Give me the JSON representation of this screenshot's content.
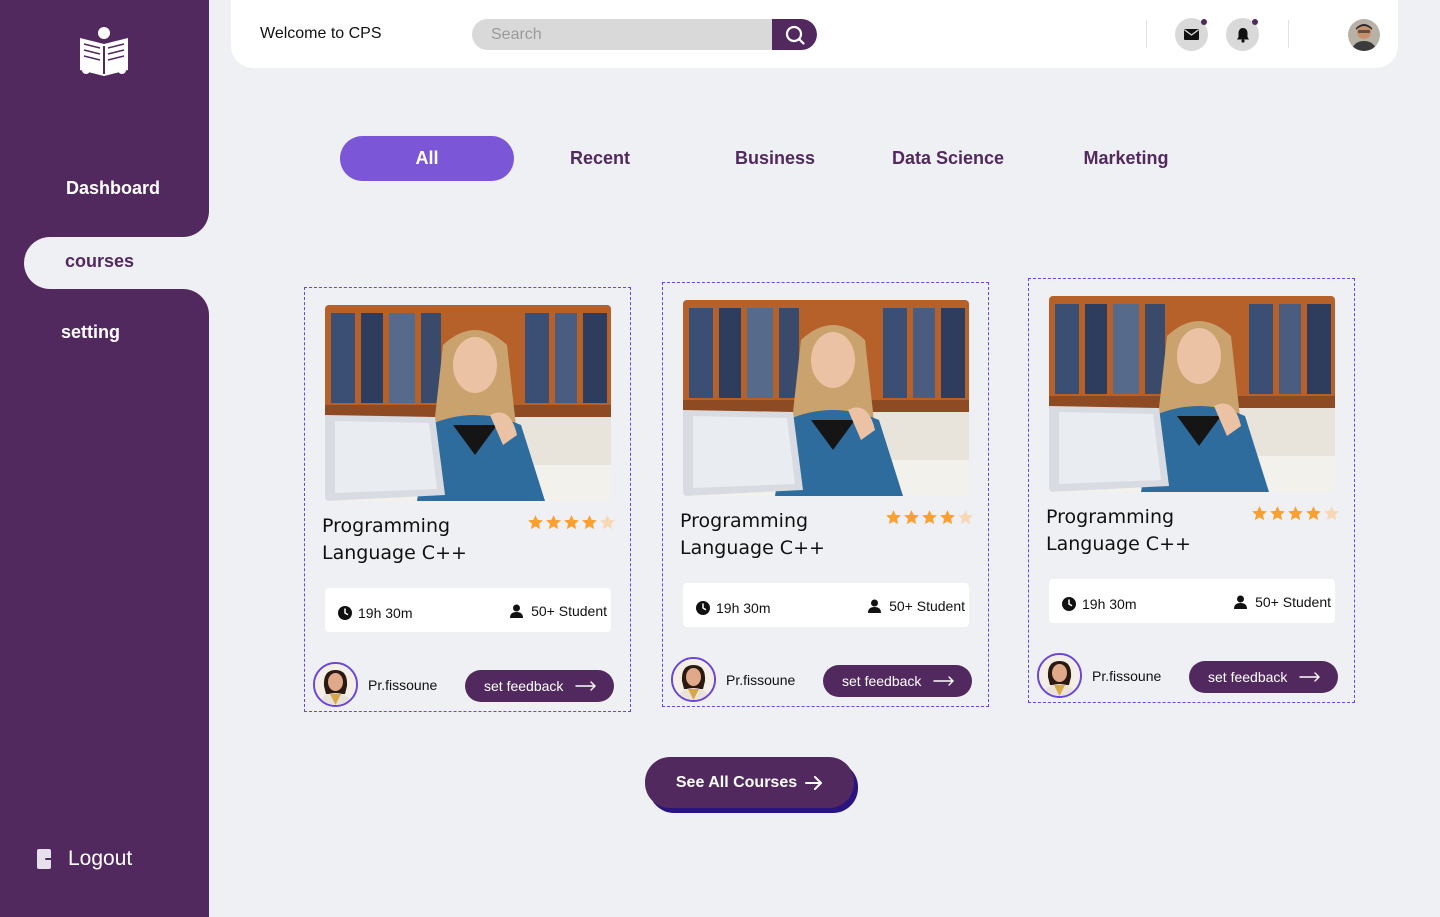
{
  "sidebar": {
    "logo_icon": "reading-person-icon",
    "items": [
      {
        "label": "Dashboard",
        "active": false
      },
      {
        "label": "courses",
        "active": true
      },
      {
        "label": "setting",
        "active": false
      }
    ],
    "logout_label": "Logout",
    "logout_icon": "logout-icon"
  },
  "header": {
    "welcome": "Welcome to CPS",
    "search_placeholder": "Search",
    "icons": [
      "mail-icon",
      "bell-icon",
      "avatar"
    ]
  },
  "tabs": [
    {
      "label": "All",
      "active": true
    },
    {
      "label": "Recent",
      "active": false
    },
    {
      "label": "Business",
      "active": false
    },
    {
      "label": "Data Science",
      "active": false
    },
    {
      "label": "Marketing",
      "active": false
    }
  ],
  "courses": [
    {
      "title_line1": "Programming",
      "title_line2": "Language C++",
      "rating": 4,
      "rating_max": 5,
      "duration": "19h 30m",
      "students": "50+ Student",
      "instructor": "Pr.fissoune",
      "feedback_label": "set feedback"
    },
    {
      "title_line1": "Programming",
      "title_line2": "Language C++",
      "rating": 4,
      "rating_max": 5,
      "duration": "19h 30m",
      "students": "50+ Student",
      "instructor": "Pr.fissoune",
      "feedback_label": "set feedback"
    },
    {
      "title_line1": "Programming",
      "title_line2": "Language C++",
      "rating": 4,
      "rating_max": 5,
      "duration": "19h 30m",
      "students": "50+ Student",
      "instructor": "Pr.fissoune",
      "feedback_label": "set feedback"
    }
  ],
  "see_all_label": "See All Courses",
  "colors": {
    "sidebar": "#52295F",
    "accent": "#7B56D6",
    "background": "#EFF0F4",
    "star": "#F9A030"
  }
}
